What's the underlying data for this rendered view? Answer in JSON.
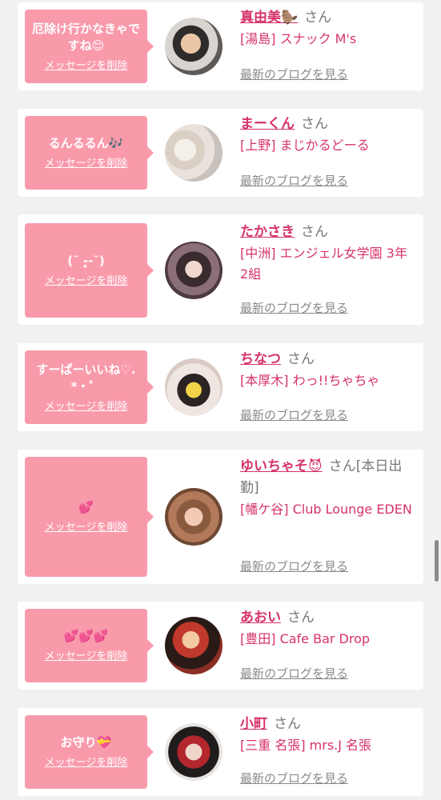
{
  "delete_label": "メッセージを削除",
  "blog_label": "最新のブログを見る",
  "san_label": "さん",
  "entries": [
    {
      "message": "厄除け行かなきゃですね😌",
      "name": "真由美🦫",
      "san": "さん",
      "shop": "[湯島] スナック M's"
    },
    {
      "message": "るんるるん🎶",
      "name": "まーくん",
      "san": "さん",
      "shop": "[上野] まじかるどーる"
    },
    {
      "message": "(˘ -̥̥-˘)",
      "name": "たかさき",
      "san": "さん",
      "shop": "[中洲] エンジェル女学園 3年2組"
    },
    {
      "message": "すーぱーいいね♡.*・゜",
      "name": "ちなつ",
      "san": "さん",
      "shop": "[本厚木] わっ!!ちゃちゃ"
    },
    {
      "message": "💕",
      "name": "ゆいちゃそ😈",
      "san": "さん[本日出勤]",
      "shop": "[幡ケ谷] Club Lounge EDEN"
    },
    {
      "message": "💕💕💕",
      "name": "あおい",
      "san": "さん",
      "shop": "[豊田] Cafe Bar Drop"
    },
    {
      "message": "お守り💝",
      "name": "小町",
      "san": "さん",
      "shop": "[三重 名張] mrs.J 名張"
    }
  ],
  "colors": {
    "accent": "#d6326c",
    "bubble": "#f99aab",
    "background": "#f3f0f1"
  }
}
